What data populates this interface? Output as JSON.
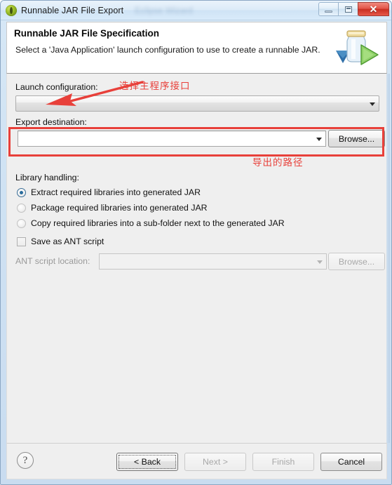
{
  "window": {
    "title": "Runnable JAR File Export",
    "ghost_title": "Eclipse   Wizard",
    "icon": "eclipse-jar-icon",
    "buttons": {
      "minimize": "minimize-icon",
      "maximize": "maximize-icon",
      "close": "✕"
    }
  },
  "header": {
    "title": "Runnable JAR File Specification",
    "description": "Select a 'Java Application' launch configuration to use to create a runnable JAR.",
    "icon": "runnable-jar-icon"
  },
  "form": {
    "launch_configuration": {
      "label": "Launch configuration:",
      "value": "",
      "placeholder": ""
    },
    "export_destination": {
      "label": "Export destination:",
      "value": "",
      "placeholder": "",
      "browse_label": "Browse..."
    },
    "library_handling": {
      "label": "Library handling:",
      "options": [
        {
          "label": "Extract required libraries into generated JAR",
          "selected": true
        },
        {
          "label": "Package required libraries into generated JAR",
          "selected": false
        },
        {
          "label": "Copy required libraries into a sub-folder next to the generated JAR",
          "selected": false
        }
      ]
    },
    "ant_script": {
      "checkbox_label": "Save as ANT script",
      "checked": false,
      "location_label": "ANT script location:",
      "location_value": "",
      "browse_label": "Browse...",
      "disabled": true
    }
  },
  "annotations": [
    {
      "id": "launch-config-note",
      "text": "选择主程序接口",
      "color": "#e8403a"
    },
    {
      "id": "export-path-note",
      "text": "导出的路径",
      "color": "#e8403a"
    }
  ],
  "footer": {
    "help": "?",
    "buttons": [
      {
        "label": "< Back",
        "state": "focused"
      },
      {
        "label": "Next >",
        "state": "disabled"
      },
      {
        "label": "Finish",
        "state": "disabled"
      },
      {
        "label": "Cancel",
        "state": "enabled"
      }
    ]
  }
}
